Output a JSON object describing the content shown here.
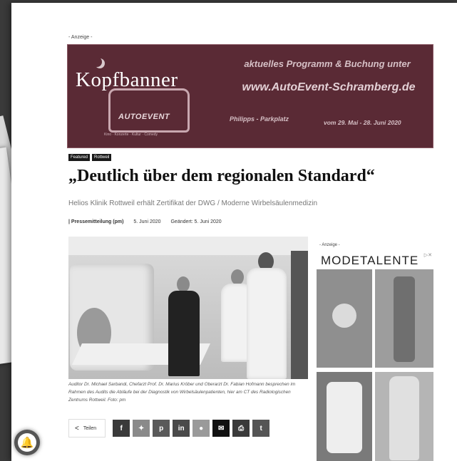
{
  "top_ad": {
    "label": "- Anzeige -",
    "overlay_label": "Kopfbanner",
    "logo": "AUTOEVENT",
    "tagline": "Kino · Konzerte · Kultur · Comedy",
    "promo": "aktuelles Programm & Buchung unter",
    "url": "www.AutoEvent-Schramberg.de",
    "sponsor": "Philipps - Parkplatz",
    "dates": "vom 29. Mai - 28. Juni 2020"
  },
  "tags": [
    "Featured",
    "Rottweil"
  ],
  "article": {
    "headline": "„Deutlich über dem regionalen Standard“",
    "subtitle": "Helios Klinik Rottweil erhält Zertifikat der DWG / Moderne Wirbelsäulenmedizin",
    "author": "Pressemitteilung (pm)",
    "date": "5. Juni 2020",
    "updated": "Geändert: 5. Juni 2020",
    "caption": "Auditor Dr. Michael Sarbandi, Chefarzt Prof. Dr. Marius Kröber und Oberarzt Dr. Fabian Hofmann besprechen im Rahmen des Audits die Abläufe bei der Diagnostik von Wirbelsäulenpatienten, hier am CT des Radiologischen Zentrums Rottweil. Foto: pm"
  },
  "share": {
    "label": "Teilen",
    "buttons": [
      {
        "name": "facebook",
        "glyph": "f",
        "color": "#3a3a3a"
      },
      {
        "name": "twitter",
        "glyph": "✦",
        "color": "#8a8a8a"
      },
      {
        "name": "pinterest",
        "glyph": "p",
        "color": "#5a5a5a"
      },
      {
        "name": "linkedin",
        "glyph": "in",
        "color": "#4a4a4a"
      },
      {
        "name": "reddit",
        "glyph": "●",
        "color": "#9a9a9a"
      },
      {
        "name": "email",
        "glyph": "✉",
        "color": "#111111"
      },
      {
        "name": "print",
        "glyph": "⎙",
        "color": "#3a3a3a"
      },
      {
        "name": "tumblr",
        "glyph": "t",
        "color": "#555555"
      }
    ]
  },
  "side_ad": {
    "label": "- Anzeige -",
    "brand": "MODETALENTE",
    "choices": "▷✕"
  }
}
